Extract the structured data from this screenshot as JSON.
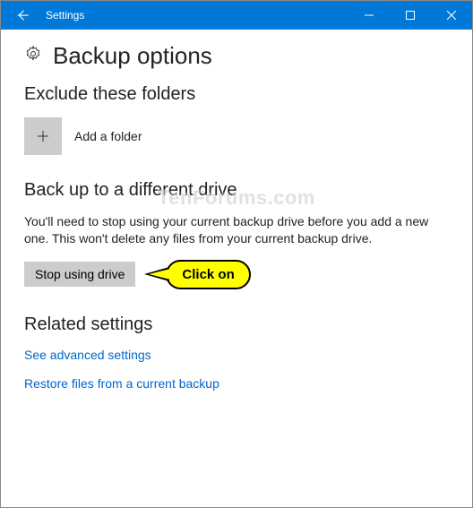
{
  "window": {
    "title": "Settings"
  },
  "page": {
    "title": "Backup options"
  },
  "exclude": {
    "heading": "Exclude these folders",
    "add_label": "Add a folder"
  },
  "backup_diff": {
    "heading": "Back up to a different drive",
    "body": "You'll need to stop using your current backup drive before you add a new one. This won't delete any files from your current backup drive.",
    "stop_button": "Stop using drive"
  },
  "callout": {
    "text": "Click on"
  },
  "related": {
    "heading": "Related settings",
    "link_advanced": "See advanced settings",
    "link_restore": "Restore files from a current backup"
  },
  "watermark": "TenForums.com"
}
